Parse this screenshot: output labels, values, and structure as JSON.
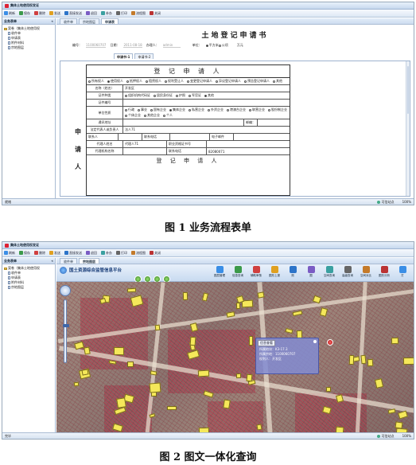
{
  "screen1": {
    "window_title": "集体土地使用权发证",
    "toolbar": [
      "刷新",
      "保存",
      "删除",
      "发送",
      "直接发送",
      "退回",
      "补办",
      "打印",
      "流程图",
      "关闭"
    ],
    "panel_title": "业务表单",
    "tree": [
      {
        "label": "案卷（集体土地使用权",
        "level": 0,
        "icon": "folder"
      },
      {
        "label": "收件单",
        "level": 1,
        "icon": "doc"
      },
      {
        "label": "申请表",
        "level": 1,
        "icon": "doc"
      },
      {
        "label": "附件材料",
        "level": 1,
        "icon": "doc"
      },
      {
        "label": "宗地图层",
        "level": 1,
        "icon": "doc"
      }
    ],
    "tabs": [
      "收件单",
      "宗地图层",
      "申请表"
    ],
    "active_tab": 2,
    "form": {
      "title": "土地登记申请书",
      "number_label": "编号：",
      "number_value": "1100060707",
      "date_label": "日期：",
      "date_value": "2011-08-18",
      "handler_label": "办理人：",
      "handler_value": "admin",
      "unit_label": "单位：",
      "unit_options": [
        {
          "label": "平方米",
          "on": true
        },
        {
          "label": "公顷",
          "on": false
        }
      ],
      "unit_extra": "万元",
      "subtabs": [
        "申请书-1",
        "申请书-2"
      ],
      "sheet_title": "登 记 申 请 人",
      "side_chars": [
        "申",
        "请",
        "人"
      ],
      "type_row": [
        {
          "label": "所有权人",
          "on": false
        },
        {
          "label": "使用权人",
          "on": true
        },
        {
          "label": "抵押权人",
          "on": false
        },
        {
          "label": "租赁权人",
          "on": false
        },
        {
          "label": "权利受让人",
          "on": false
        },
        {
          "label": "变更登记申请人",
          "on": false
        },
        {
          "label": "异议登记申请人",
          "on": false
        },
        {
          "label": "预告登记申请人",
          "on": false
        },
        {
          "label": "其他",
          "on": false
        }
      ],
      "name_label": "名称（姓名）",
      "name_value": "开发区",
      "id_type_label": "证件种类",
      "id_types": [
        {
          "label": "组织机构代码证",
          "on": false
        },
        {
          "label": "居民身份证",
          "on": false
        },
        {
          "label": "护照",
          "on": false
        },
        {
          "label": "军官证",
          "on": false
        },
        {
          "label": "其他",
          "on": true
        }
      ],
      "id_no_label": "证件编号",
      "unit_nature_label": "单位性质",
      "unit_natures": [
        {
          "label": "行政",
          "on": false
        },
        {
          "label": "事业",
          "on": false
        },
        {
          "label": "国有企业",
          "on": false
        },
        {
          "label": "集体企业",
          "on": true
        },
        {
          "label": "私营企业",
          "on": false
        },
        {
          "label": "外资企业",
          "on": false
        },
        {
          "label": "港澳台企业",
          "on": false
        },
        {
          "label": "联营企业",
          "on": false
        },
        {
          "label": "股份制企业",
          "on": false
        },
        {
          "label": "个体企业",
          "on": false
        },
        {
          "label": "其他企业",
          "on": false
        },
        {
          "label": "个人",
          "on": false
        }
      ],
      "address_label": "通讯地址",
      "postcode_label": "邮编：",
      "legal_label": "法定代表人或负责人",
      "legal_value": "法人71",
      "contact_label": "联系人",
      "contact_phone_label": "联系电话",
      "email_label": "电子邮件",
      "agent_label": "代理人姓名",
      "agent_value": "代理人71",
      "agent_cert_label": "职业资格证书号",
      "agency_label": "代理机构名称",
      "agency_phone_label": "联系电话",
      "agency_phone_value": "82080071",
      "bottom_title": "登 记 申 请 人"
    },
    "status": {
      "left": "就绪",
      "zone": "可信站点",
      "zoom": "100%"
    },
    "caption": "图 1 业务流程表单"
  },
  "screen2": {
    "window_title": "集体土地使用权发证",
    "toolbar": [
      "刷新",
      "保存",
      "删除",
      "发送",
      "直接发送",
      "退回",
      "补办",
      "打印",
      "流程图",
      "关闭"
    ],
    "panel_title": "业务表单",
    "tree": [
      {
        "label": "案卷（集体土地使用权",
        "level": 0,
        "icon": "folder"
      },
      {
        "label": "收件单",
        "level": 1,
        "icon": "doc"
      },
      {
        "label": "申请表",
        "level": 1,
        "icon": "doc"
      },
      {
        "label": "附件材料",
        "level": 1,
        "icon": "doc"
      },
      {
        "label": "宗地图层",
        "level": 1,
        "icon": "doc"
      }
    ],
    "tabs": [
      "收件单",
      "宗地图层"
    ],
    "active_tab": 1,
    "map_title": "国土资源综合监管信息平台",
    "map_tools": [
      "图层管理",
      "信息查询",
      "辅助审核",
      "图形上报",
      "测",
      "图",
      "空间查询",
      "高级查询",
      "空间对比",
      "图形分析",
      "打"
    ],
    "popup": {
      "title": "信息查看",
      "lines": [
        "所属地块：K3-17.3",
        "所属宗地：1100060707",
        "权利人：开发区"
      ]
    },
    "status": {
      "left": "完毕",
      "zone": "可信站点",
      "zoom": "100%"
    },
    "caption": "图 2 图文一体化查询"
  },
  "colors": {
    "accent": "#1b3f7a",
    "parcel": "#f5e85a",
    "alert": "#c82846"
  }
}
